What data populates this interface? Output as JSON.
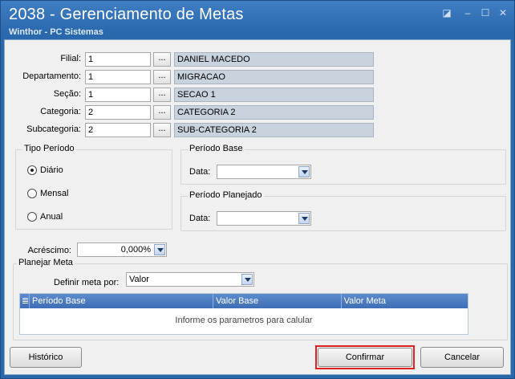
{
  "window": {
    "title": "2038 - Gerenciamento de Metas",
    "subtitle": "Winthor - PC Sistemas",
    "controls": [
      "restore-icon",
      "minimize-icon",
      "maximize-icon",
      "close-icon"
    ]
  },
  "fields": {
    "filial": {
      "label": "Filial:",
      "value": "1",
      "button": "...",
      "description": "DANIEL MACEDO"
    },
    "departamento": {
      "label": "Departamento:",
      "value": "1",
      "button": "...",
      "description": "MIGRACAO"
    },
    "secao": {
      "label": "Seção:",
      "value": "1",
      "button": "...",
      "description": "SECAO 1"
    },
    "categoria": {
      "label": "Categoria:",
      "value": "2",
      "button": "...",
      "description": "CATEGORIA 2"
    },
    "subcategoria": {
      "label": "Subcategoria:",
      "value": "2",
      "button": "...",
      "description": "SUB-CATEGORIA 2"
    }
  },
  "tipo_periodo": {
    "title": "Tipo Período",
    "options": [
      {
        "label": "Diário",
        "selected": true
      },
      {
        "label": "Mensal",
        "selected": false
      },
      {
        "label": "Anual",
        "selected": false
      }
    ]
  },
  "periodo_base": {
    "title": "Período Base",
    "data_label": "Data:",
    "value": ""
  },
  "periodo_planejado": {
    "title": "Período Planejado",
    "data_label": "Data:",
    "value": ""
  },
  "acrescimo": {
    "label": "Acréscimo:",
    "value": "0,000%"
  },
  "planejar_meta": {
    "title": "Planejar Meta",
    "definir_label": "Definir meta por:",
    "definir_value": "Valor",
    "columns": [
      "Período Base",
      "Valor Base",
      "Valor Meta"
    ],
    "empty_message": "Informe os parametros para calular"
  },
  "buttons": {
    "historico": "Histórico",
    "confirmar": "Confirmar",
    "cancelar": "Cancelar"
  },
  "colors": {
    "titlebar": "#2a68ad",
    "highlight": "#e02020",
    "grid_header": "#3d6db5"
  }
}
